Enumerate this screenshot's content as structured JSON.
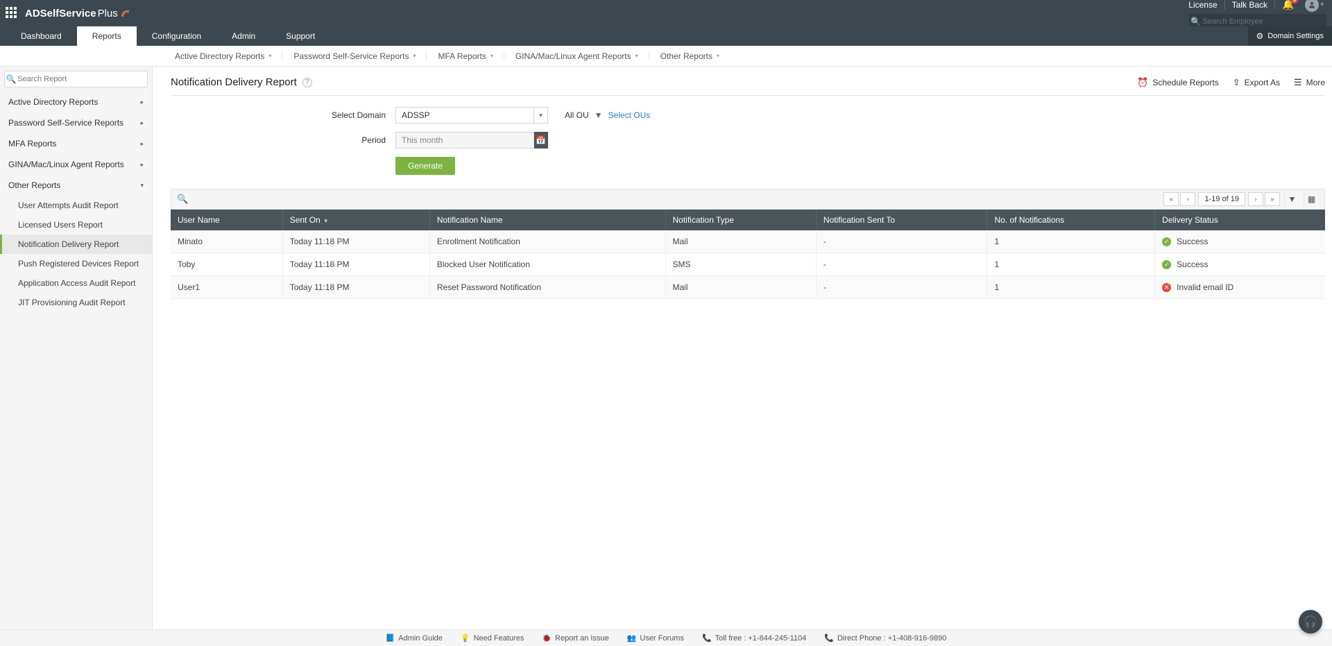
{
  "header": {
    "product_bold": "ADSelfService",
    "product_light": "Plus",
    "license": "License",
    "talkback": "Talk Back",
    "bell_count": "1",
    "search_placeholder": "Search Employee",
    "domain_settings": "Domain Settings"
  },
  "tabs": {
    "items": [
      "Dashboard",
      "Reports",
      "Configuration",
      "Admin",
      "Support"
    ],
    "active": 1
  },
  "subtabs": {
    "items": [
      "Active Directory Reports",
      "Password Self-Service Reports",
      "MFA Reports",
      "GINA/Mac/Linux Agent Reports",
      "Other Reports"
    ]
  },
  "sidebar": {
    "search_placeholder": "Search Report",
    "groups": [
      "Active Directory Reports",
      "Password Self-Service Reports",
      "MFA Reports",
      "GINA/Mac/Linux Agent Reports",
      "Other Reports"
    ],
    "other_items": [
      "User Attempts Audit Report",
      "Licensed Users Report",
      "Notification Delivery Report",
      "Push Registered Devices Report",
      "Application Access Audit Report",
      "JIT Provisioning Audit Report"
    ],
    "active_other": 2
  },
  "page": {
    "title": "Notification Delivery Report",
    "schedule": "Schedule Reports",
    "export": "Export As",
    "more": "More"
  },
  "filters": {
    "domain_label": "Select Domain",
    "domain_value": "ADSSP",
    "all_ou": "All OU",
    "select_ous": "Select OUs",
    "period_label": "Period",
    "period_value": "This month",
    "generate": "Generate"
  },
  "table": {
    "pager_text": "1-19 of 19",
    "columns": [
      "User Name",
      "Sent On",
      "Notification Name",
      "Notification Type",
      "Notification Sent To",
      "No. of Notifications",
      "Delivery Status"
    ],
    "rows": [
      {
        "user": "Minato",
        "sent": "Today 11:18 PM",
        "name": "Enrollment Notification",
        "type": "Mail",
        "to": "-",
        "count": "1",
        "status": "Success",
        "ok": true
      },
      {
        "user": "Toby",
        "sent": "Today 11:18 PM",
        "name": "Blocked User Notification",
        "type": "SMS",
        "to": "-",
        "count": "1",
        "status": "Success",
        "ok": true
      },
      {
        "user": "User1",
        "sent": "Today 11:18 PM",
        "name": "Reset Password Notification",
        "type": "Mail",
        "to": "-",
        "count": "1",
        "status": "Invalid email ID",
        "ok": false
      }
    ]
  },
  "footer": {
    "admin_guide": "Admin Guide",
    "need_features": "Need Features",
    "report_issue": "Report an Issue",
    "user_forums": "User Forums",
    "tollfree": "Toll free : +1-844-245-1104",
    "direct": "Direct Phone : +1-408-916-9890"
  }
}
